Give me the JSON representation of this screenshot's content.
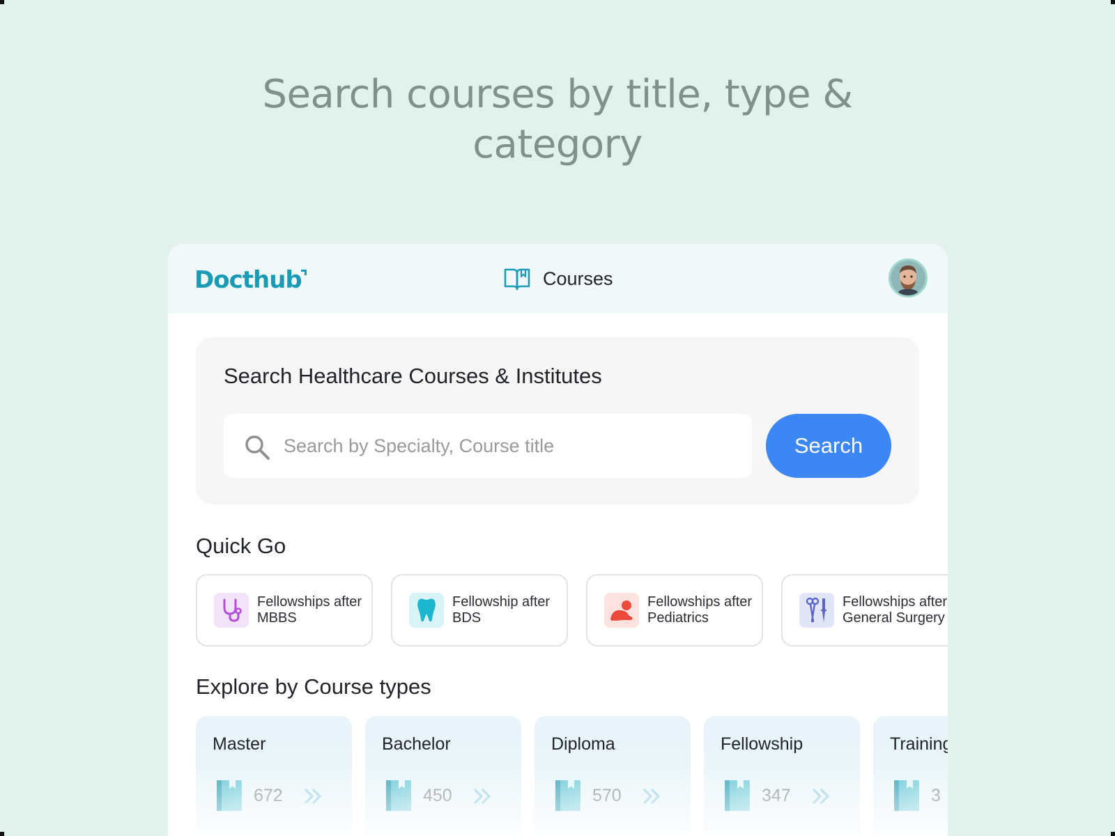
{
  "headline": {
    "line1": "Search courses by title, type &",
    "line2": "category"
  },
  "header": {
    "logo": "Docthub",
    "nav_courses": "Courses",
    "nav_icon": "book-open-icon",
    "avatar_icon": "user-avatar"
  },
  "search": {
    "title": "Search Healthcare Courses & Institutes",
    "placeholder": "Search by Specialty, Course title",
    "value": "",
    "button": "Search"
  },
  "quick_go": {
    "title": "Quick Go",
    "items": [
      {
        "label": "Fellowships after MBBS",
        "icon": "stethoscope-icon",
        "color": "#b34fd6",
        "bg": "#f1e3f8"
      },
      {
        "label": "Fellowship after BDS",
        "icon": "tooth-icon",
        "color": "#1bb7cf",
        "bg": "#d9f3f7"
      },
      {
        "label": "Fellowships after Pediatrics",
        "icon": "baby-icon",
        "color": "#ec4b3c",
        "bg": "#fde2df"
      },
      {
        "label": "Fellowships after General Surgery",
        "icon": "surgical-tools-icon",
        "color": "#5a66c7",
        "bg": "#e2e5f7"
      }
    ]
  },
  "course_types": {
    "title": "Explore by Course types",
    "items": [
      {
        "label": "Master",
        "count": "672"
      },
      {
        "label": "Bachelor",
        "count": "450"
      },
      {
        "label": "Diploma",
        "count": "570"
      },
      {
        "label": "Fellowship",
        "count": "347"
      },
      {
        "label": "Training",
        "count": "3"
      }
    ]
  },
  "colors": {
    "background": "#e3f1ec",
    "brand": "#1a9bb5",
    "primary_button": "#3d86f5"
  }
}
